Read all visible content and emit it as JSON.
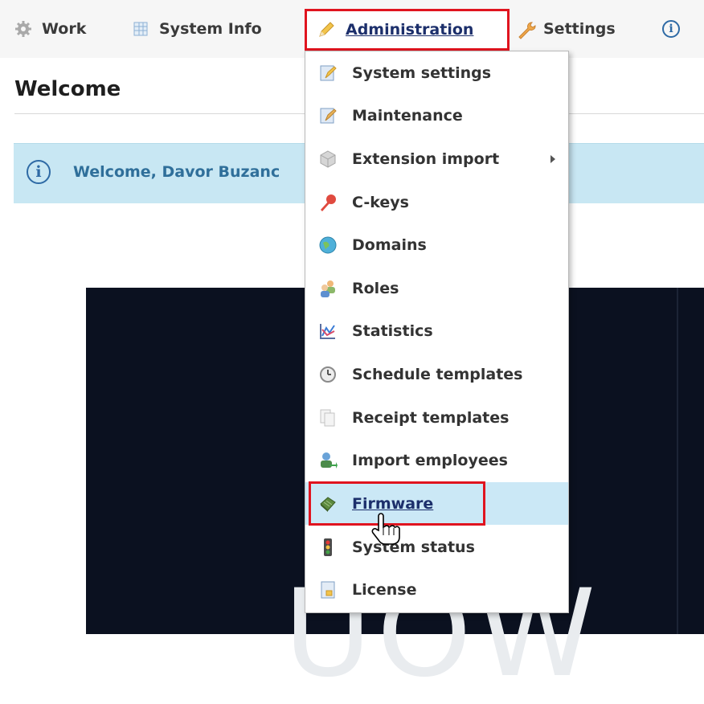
{
  "menubar": {
    "items": [
      {
        "label": "Work",
        "icon": "gear-icon"
      },
      {
        "label": "System Info",
        "icon": "table-icon"
      },
      {
        "label": "Administration",
        "icon": "pencil-icon"
      },
      {
        "label": "Settings",
        "icon": "wrench-icon"
      },
      {
        "label": "",
        "icon": "info-icon"
      }
    ]
  },
  "page": {
    "title": "Welcome",
    "welcome_message": "Welcome, Davor Buzanc",
    "panel_text": "UOW"
  },
  "dropdown": {
    "items": [
      {
        "label": "System settings",
        "icon": "settings-doc-icon"
      },
      {
        "label": "Maintenance",
        "icon": "maintenance-doc-icon"
      },
      {
        "label": "Extension import",
        "icon": "extension-cube-icon",
        "has_submenu": true
      },
      {
        "label": "C-keys",
        "icon": "key-icon"
      },
      {
        "label": "Domains",
        "icon": "globe-icon"
      },
      {
        "label": "Roles",
        "icon": "users-icon"
      },
      {
        "label": "Statistics",
        "icon": "chart-icon"
      },
      {
        "label": "Schedule templates",
        "icon": "clock-icon"
      },
      {
        "label": "Receipt templates",
        "icon": "pages-icon"
      },
      {
        "label": "Import employees",
        "icon": "import-user-icon"
      },
      {
        "label": "Firmware",
        "icon": "chip-icon",
        "hovered": true
      },
      {
        "label": "System status",
        "icon": "traffic-light-icon"
      },
      {
        "label": "License",
        "icon": "license-doc-icon"
      }
    ]
  },
  "colors": {
    "highlight_border": "#e0141f",
    "hover_bg": "#cbe8f6",
    "info_bar_bg": "#c8e7f3",
    "dark_panel": "#0b1120"
  }
}
